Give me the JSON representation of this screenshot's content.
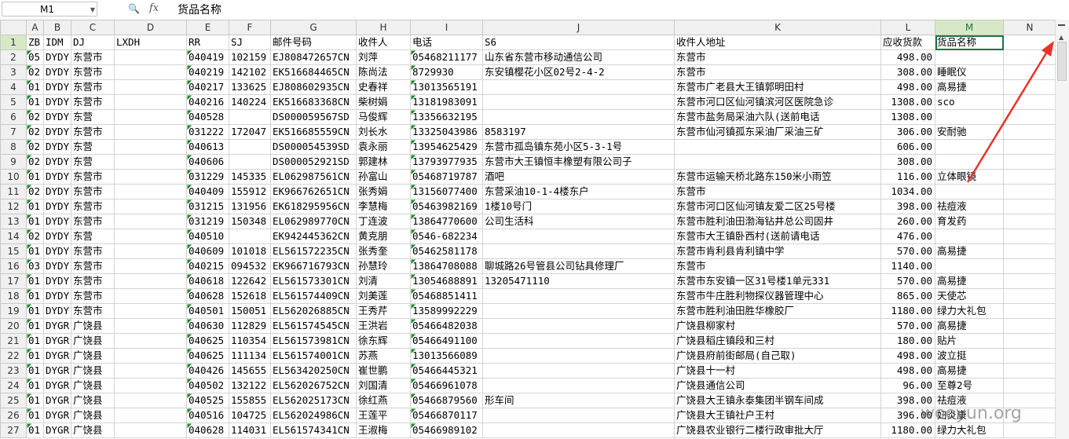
{
  "formula_bar": {
    "cell_ref": "M1",
    "zoom_icon": "zoom-icon",
    "fx_label": "fx",
    "content": "货品名称"
  },
  "columns": [
    "A",
    "B",
    "C",
    "D",
    "E",
    "F",
    "G",
    "H",
    "I",
    "J",
    "K",
    "L",
    "M",
    "N"
  ],
  "rows": [
    {
      "n": "1",
      "c": [
        "ZB",
        "IDM",
        "DJ",
        "LXDH",
        "RR",
        "SJ",
        "邮件号码",
        "收件人",
        "电话",
        "S6",
        "收件人地址",
        "应收货款",
        "货品名称",
        ""
      ]
    },
    {
      "n": "2",
      "c": [
        "05",
        "DYDY",
        "东营市",
        "",
        "040419",
        "102159",
        "EJ808472657CN",
        "刘萍",
        "05468211177",
        "山东省东营市移动通信公司",
        "东营市",
        "498.00",
        "",
        ""
      ]
    },
    {
      "n": "3",
      "c": [
        "02",
        "DYDY",
        "东营市",
        "",
        "040219",
        "142102",
        "EK516684465CN",
        "陈尚法",
        "8729930",
        "东安镇樱花小区02号2-4-2",
        "东营市",
        "308.00",
        "睡眠仪",
        ""
      ]
    },
    {
      "n": "4",
      "c": [
        "01",
        "DYDY",
        "东营市",
        "",
        "040217",
        "133625",
        "EJ808602935CN",
        "史春祥",
        "13013565191",
        "",
        "东营市广老县大王镇郭明田村",
        "498.00",
        "高易捷",
        ""
      ]
    },
    {
      "n": "5",
      "c": [
        "01",
        "DYDY",
        "东营市",
        "",
        "040216",
        "140224",
        "EK516683368CN",
        "柴树娟",
        "13181983091",
        "",
        "东营市河口区仙河镇滨河区医院急诊",
        "1308.00",
        "sco",
        ""
      ]
    },
    {
      "n": "6",
      "c": [
        "02",
        "DYDY",
        "东营",
        "",
        "040528",
        "",
        "DS000059567SD",
        "马俊辉",
        "13356632195",
        "",
        "东营市盐务局采油六队(送前电话",
        "1308.00",
        "",
        ""
      ]
    },
    {
      "n": "7",
      "c": [
        "02",
        "DYDY",
        "东营市",
        "",
        "031222",
        "172047",
        "EK516685559CN",
        "刘长水",
        "13325043986",
        "8583197",
        "东营市仙河镇孤东采油厂采油三矿",
        "306.00",
        "安耐驰",
        ""
      ]
    },
    {
      "n": "8",
      "c": [
        "02",
        "DYDY",
        "东营",
        "",
        "040613",
        "",
        "DS000054539SD",
        "袁永丽",
        "13954625429",
        "东营市孤岛镇东苑小区5-3-1号",
        "",
        "606.00",
        "",
        ""
      ]
    },
    {
      "n": "9",
      "c": [
        "02",
        "DYDY",
        "东营",
        "",
        "040606",
        "",
        "DS000052921SD",
        "郭建林",
        "13793977935",
        "东营市大王镇恒丰橡塑有限公司子",
        "",
        "308.00",
        "",
        ""
      ]
    },
    {
      "n": "10",
      "c": [
        "01",
        "DYDY",
        "东营市",
        "",
        "031229",
        "145335",
        "EL062987561CN",
        "孙富山",
        "05468719787",
        "酒吧",
        "东营市运输天桥北路东150米小雨笠",
        "116.00",
        "立体眼镜",
        ""
      ]
    },
    {
      "n": "11",
      "c": [
        "02",
        "DYDY",
        "东营市",
        "",
        "040409",
        "155912",
        "EK966762651CN",
        "张秀娟",
        "13156077400",
        "东营采油10-1-4楼东户",
        "东营市",
        "1034.00",
        "",
        ""
      ]
    },
    {
      "n": "12",
      "c": [
        "01",
        "DYDY",
        "东营市",
        "",
        "031215",
        "131956",
        "EK618295956CN",
        "李慧梅",
        "05463982169",
        "1楼10号门",
        "东营市河口区仙河镇友爱二区25号楼",
        "398.00",
        "祛痘液",
        ""
      ]
    },
    {
      "n": "13",
      "c": [
        "01",
        "DYDY",
        "东营市",
        "",
        "031219",
        "150348",
        "EL062989770CN",
        "丁连波",
        "13864770600",
        "公司生活科",
        "东营市胜利油田渤海钻井总公司固井",
        "260.00",
        "育发药",
        ""
      ]
    },
    {
      "n": "14",
      "c": [
        "02",
        "DYDY",
        "东营",
        "",
        "040510",
        "",
        "EK942445362CN",
        "黄克朋",
        "0546-682234",
        "",
        "东营市大王镇卧西村(送前请电话",
        "476.00",
        "",
        ""
      ]
    },
    {
      "n": "15",
      "c": [
        "01",
        "DYDY",
        "东营市",
        "",
        "040609",
        "101018",
        "EL561572235CN",
        "张秀奎",
        "05462581178",
        "",
        "东营市肯利县肯利镇中学",
        "570.00",
        "高易捷",
        ""
      ]
    },
    {
      "n": "16",
      "c": [
        "03",
        "DYDY",
        "东营市",
        "",
        "040215",
        "094532",
        "EK966716793CN",
        "孙慧玲",
        "13864708088",
        "聊城路26号管县公司钻具修理厂",
        "东营市",
        "1140.00",
        "",
        ""
      ]
    },
    {
      "n": "17",
      "c": [
        "01",
        "DYDY",
        "东营市",
        "",
        "040618",
        "122642",
        "EL561573301CN",
        "刘清",
        "13054688891",
        "13205471110",
        "东营市东安镇一区31号楼1单元331",
        "570.00",
        "高易捷",
        ""
      ]
    },
    {
      "n": "18",
      "c": [
        "01",
        "DYDY",
        "东营市",
        "",
        "040628",
        "152618",
        "EL561574409CN",
        "刘美莲",
        "05468851411",
        "",
        "东营市牛庄胜利物探仪器管理中心",
        "865.00",
        "天使芯",
        ""
      ]
    },
    {
      "n": "19",
      "c": [
        "01",
        "DYDY",
        "东营市",
        "",
        "040501",
        "150051",
        "EL562026885CN",
        "王秀芹",
        "13589992229",
        "",
        "东营市胜利油田胜华橡胶厂",
        "1180.00",
        "绿力大礼包",
        ""
      ]
    },
    {
      "n": "20",
      "c": [
        "01",
        "DYGR",
        "广饶县",
        "",
        "040630",
        "112829",
        "EL561574545CN",
        "王洪岩",
        "05466482038",
        "",
        "广饶县柳家村",
        "570.00",
        "高易捷",
        ""
      ]
    },
    {
      "n": "21",
      "c": [
        "01",
        "DYGR",
        "广饶县",
        "",
        "040625",
        "110354",
        "EL561573981CN",
        "徐东辉",
        "05466491100",
        "",
        "广饶县稻庄镇段和三村",
        "180.00",
        "贴片",
        ""
      ]
    },
    {
      "n": "22",
      "c": [
        "01",
        "DYGR",
        "广饶县",
        "",
        "040625",
        "111134",
        "EL561574001CN",
        "苏燕",
        "13013566089",
        "",
        "广饶县府前街邮局(自己取)",
        "498.00",
        "波立挺",
        ""
      ]
    },
    {
      "n": "23",
      "c": [
        "01",
        "DYGR",
        "广饶县",
        "",
        "040426",
        "145655",
        "EL563420250CN",
        "崔世鹏",
        "05466445321",
        "",
        "广饶县十一村",
        "498.00",
        "高易捷",
        ""
      ]
    },
    {
      "n": "24",
      "c": [
        "01",
        "DYGR",
        "广饶县",
        "",
        "040502",
        "132122",
        "EL562026752CN",
        "刘国清",
        "05466961078",
        "",
        "广饶县通信公司",
        "96.00",
        "至尊2号",
        ""
      ]
    },
    {
      "n": "25",
      "c": [
        "01",
        "DYGR",
        "广饶县",
        "",
        "040525",
        "155855",
        "EL562025173CN",
        "徐红燕",
        "05466879560",
        "形车间",
        "广饶县大王镇永泰集团半钢车间成",
        "398.00",
        "祛痘液",
        ""
      ]
    },
    {
      "n": "26",
      "c": [
        "01",
        "DYGR",
        "广饶县",
        "",
        "040516",
        "104725",
        "EL562024986CN",
        "王莲平",
        "05466870117",
        "",
        "广饶县大王镇社户王村",
        "396.00",
        "妇炎康",
        ""
      ]
    },
    {
      "n": "27",
      "c": [
        "01",
        "DYGR",
        "广饶县",
        "",
        "040628",
        "114031",
        "EL561574341CN",
        "王淑梅",
        "05466989102",
        "",
        "广饶县农业银行二楼行政审批大厅",
        "1180.00",
        "绿力大礼包",
        ""
      ]
    }
  ],
  "watermark": "wooyun.org",
  "annotation_arrow_color": "#e8322a",
  "accent_color": "#217346"
}
